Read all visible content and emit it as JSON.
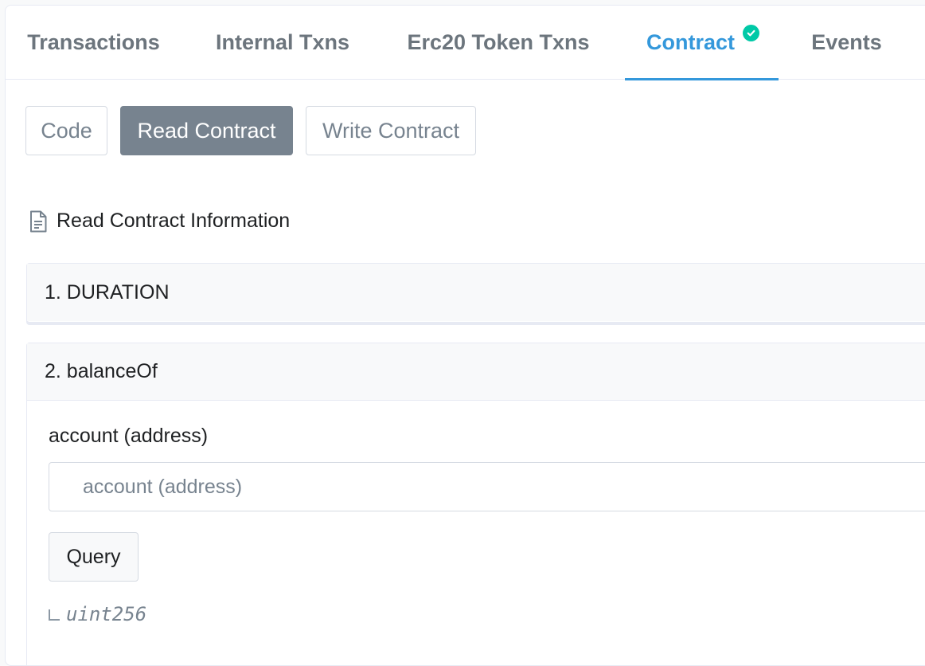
{
  "tabs": [
    {
      "label": "Transactions"
    },
    {
      "label": "Internal Txns"
    },
    {
      "label": "Erc20 Token Txns"
    },
    {
      "label": "Contract",
      "active": true,
      "verified": true
    },
    {
      "label": "Events"
    }
  ],
  "subnav": {
    "code_label": "Code",
    "read_label": "Read Contract",
    "write_label": "Write Contract"
  },
  "section": {
    "title": "Read Contract Information",
    "icon": "document-icon"
  },
  "functions": [
    {
      "label": "1. DURATION"
    },
    {
      "label": "2. balanceOf",
      "input_label": "account (address)",
      "input_placeholder": "account (address)",
      "input_value": "",
      "query_label": "Query",
      "output_type": "uint256"
    }
  ],
  "colors": {
    "accent": "#3498db",
    "verified_badge": "#00c9a7",
    "active_button": "#77838f"
  }
}
